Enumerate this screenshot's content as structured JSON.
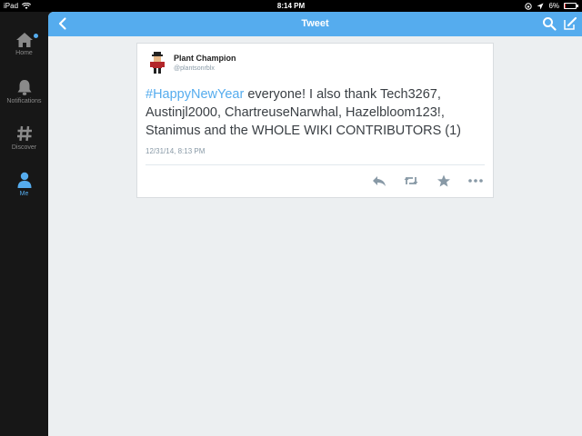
{
  "status_bar": {
    "device": "iPad",
    "time": "8:14 PM",
    "battery_text": "6%",
    "battery_level": 0.06
  },
  "sidebar": {
    "items": [
      {
        "label": "Home",
        "icon": "home-icon",
        "active": false,
        "has_dot": true
      },
      {
        "label": "Notifications",
        "icon": "bell-icon",
        "active": false
      },
      {
        "label": "Discover",
        "icon": "hashtag-icon",
        "active": false
      },
      {
        "label": "Me",
        "icon": "person-icon",
        "active": true
      }
    ]
  },
  "navbar": {
    "title": "Tweet",
    "back_icon": "chevron-left-icon",
    "search_icon": "search-icon",
    "compose_icon": "compose-icon"
  },
  "tweet": {
    "author_name": "Plant Champion",
    "handle": "@plantsonrblx",
    "hashtag": "#HappyNewYear",
    "body": " everyone! I also thank Tech3267, Austinjl2000, ChartreuseNarwhal, Hazelbloom123!, Stanimus and the WHOLE WIKI CONTRIBUTORS (1)",
    "timestamp": "12/31/14, 8:13 PM",
    "actions": [
      "reply-icon",
      "retweet-icon",
      "favorite-star-icon",
      "more-icon"
    ]
  },
  "colors": {
    "accent": "#55acee",
    "sidebar_bg": "#171717",
    "content_bg": "#eceff1"
  }
}
